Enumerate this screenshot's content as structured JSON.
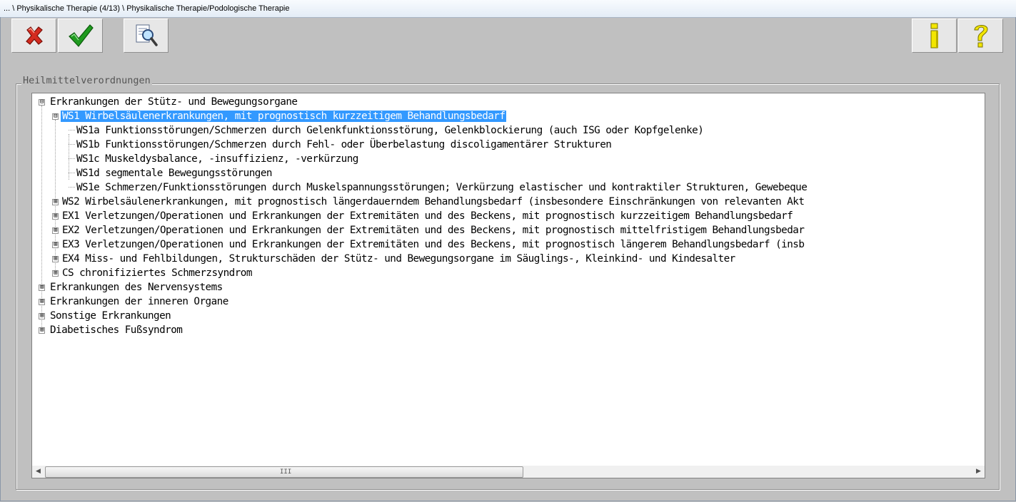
{
  "window": {
    "title": "... \\ Physikalische Therapie (4/13) \\ Physikalische Therapie/Podologische Therapie"
  },
  "toolbar": {
    "cancel_icon": "red-x-icon",
    "ok_icon": "green-check-icon",
    "search_icon": "magnifier-document-icon",
    "info_icon": "info-icon",
    "help_icon": "question-mark-icon"
  },
  "group": {
    "legend": "Heilmittelverordnungen"
  },
  "tree": {
    "nodes": [
      {
        "label": "Erkrankungen der Stütz- und Bewegungsorgane",
        "expander": "⊟"
      },
      {
        "label": "WS1 Wirbelsäulenerkrankungen, mit prognostisch kurzzeitigem Behandlungsbedarf",
        "expander": "⊟",
        "selected": true
      },
      {
        "label": "WS1a Funktionsstörungen/Schmerzen durch Gelenkfunktionsstörung, Gelenkblockierung (auch ISG oder Kopfgelenke)"
      },
      {
        "label": "WS1b Funktionsstörungen/Schmerzen durch Fehl- oder Überbelastung discoligamentärer Strukturen"
      },
      {
        "label": "WS1c Muskeldysbalance, -insuffizienz, -verkürzung"
      },
      {
        "label": "WS1d segmentale Bewegungsstörungen"
      },
      {
        "label": "WS1e Schmerzen/Funktionsstörungen durch Muskelspannungsstörungen; Verkürzung elastischer und kontraktiler Strukturen, Gewebeque"
      },
      {
        "label": "WS2 Wirbelsäulenerkrankungen, mit prognostisch längerdauerndem Behandlungsbedarf (insbesondere Einschränkungen von relevanten Akt",
        "expander": "⊞"
      },
      {
        "label": "EX1 Verletzungen/Operationen und Erkrankungen der Extremitäten und des Beckens, mit prognostisch kurzzeitigem Behandlungsbedarf",
        "expander": "⊞"
      },
      {
        "label": "EX2 Verletzungen/Operationen und Erkrankungen der Extremitäten und des Beckens, mit prognostisch mittelfristigem Behandlungsbedar",
        "expander": "⊞"
      },
      {
        "label": "EX3 Verletzungen/Operationen und Erkrankungen der Extremitäten und des Beckens, mit prognostisch längerem Behandlungsbedarf (insb",
        "expander": "⊞"
      },
      {
        "label": "EX4 Miss- und Fehlbildungen, Strukturschäden der Stütz- und Bewegungsorgane im Säuglings-, Kleinkind- und Kindesalter",
        "expander": "⊞"
      },
      {
        "label": "CS chronifiziertes Schmerzsyndrom",
        "expander": "⊞"
      },
      {
        "label": "Erkrankungen des Nervensystems",
        "expander": "⊞"
      },
      {
        "label": "Erkrankungen der inneren Organe",
        "expander": "⊞"
      },
      {
        "label": "Sonstige Erkrankungen",
        "expander": "⊞"
      },
      {
        "label": "Diabetisches Fußsyndrom",
        "expander": "⊞"
      }
    ]
  },
  "scrollbar": {
    "left_arrow": "◀",
    "right_arrow": "▶",
    "grip": "III"
  },
  "colors": {
    "selection": "#3399ff",
    "background": "#c0c0c0"
  }
}
